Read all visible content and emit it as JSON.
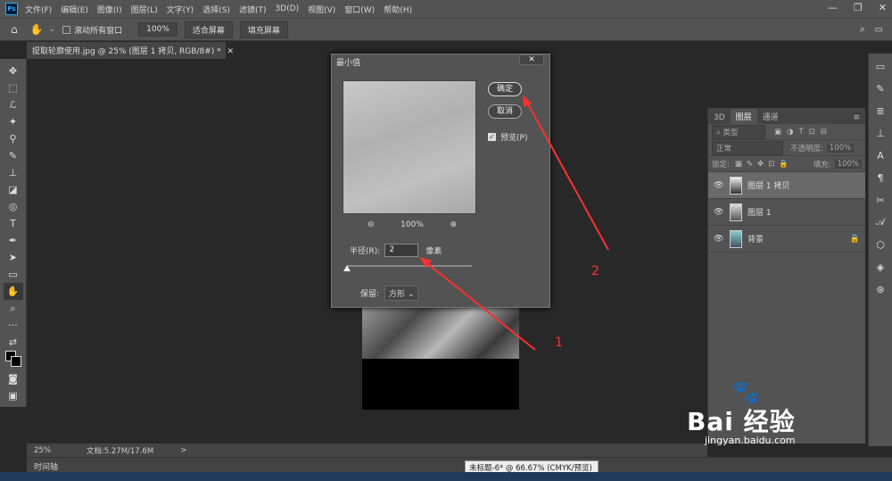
{
  "app": {
    "logo": "Ps",
    "menu": [
      "文件(F)",
      "编辑(E)",
      "图像(I)",
      "图层(L)",
      "文字(Y)",
      "选择(S)",
      "滤镜(T)",
      "3D(D)",
      "视图(V)",
      "窗口(W)",
      "帮助(H)"
    ],
    "window_controls": [
      "—",
      "❐",
      "✕"
    ]
  },
  "options_bar": {
    "scroll_all": "滚动所有窗口",
    "zoom": "100%",
    "fit_screen": "适合屏幕",
    "fill_screen": "填充屏幕"
  },
  "document_tab": "提取轮廓使用.jpg @ 25% (图层 1 拷贝, RGB/8#) *",
  "dialog": {
    "title": "最小值",
    "close": "✕",
    "ok": "确定",
    "cancel": "取消",
    "preview_label": "预览(P)",
    "zoom": "100%",
    "radius_label": "半径(R):",
    "radius_value": "2",
    "radius_unit": "像素",
    "keep_label": "保留:",
    "keep_value": "方形"
  },
  "layers_panel": {
    "tabs": [
      "3D",
      "图层",
      "通道"
    ],
    "filter_label": "类型",
    "blend_mode": "正常",
    "opacity_label": "不透明度:",
    "opacity_value": "100%",
    "lock_label": "锁定:",
    "fill_label": "填充:",
    "fill_value": "100%",
    "layers": [
      {
        "name": "图层 1 拷贝",
        "selected": true
      },
      {
        "name": "图层 1",
        "selected": false
      },
      {
        "name": "背景",
        "selected": false,
        "locked": true
      }
    ]
  },
  "status": {
    "zoom": "25%",
    "doc_info": "文档:5.27M/17.6M",
    "arrow": ">"
  },
  "timeline_label": "时间轴",
  "tooltip": "未标题-6* @ 66.67% (CMYK/预览)",
  "annotations": [
    "1",
    "2"
  ],
  "watermark": {
    "brand": "Bai 经验",
    "url": "jingyan.baidu.com"
  }
}
